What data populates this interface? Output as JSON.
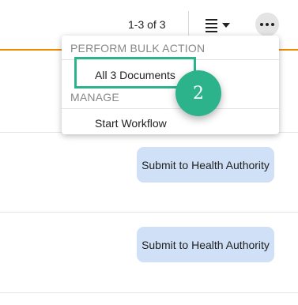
{
  "header": {
    "pager": "1-3 of 3",
    "list_view_icon": "list-view-icon",
    "more_icon": "more-horizontal-icon"
  },
  "menu": {
    "sections": [
      {
        "header": "PERFORM BULK ACTION",
        "items": [
          "All 3 Documents"
        ]
      },
      {
        "header": "MANAGE",
        "items": [
          "Start Workflow"
        ]
      }
    ]
  },
  "rows": [
    {
      "action_label": "Submit to Health Authority"
    },
    {
      "action_label": "Submit to Health Authority"
    }
  ],
  "callout": {
    "step": "2"
  },
  "colors": {
    "accent_orange": "#f08c00",
    "callout_green": "#2db38c",
    "action_button_bg": "#cfe0f7",
    "more_button_bg": "#e4e4e4"
  }
}
